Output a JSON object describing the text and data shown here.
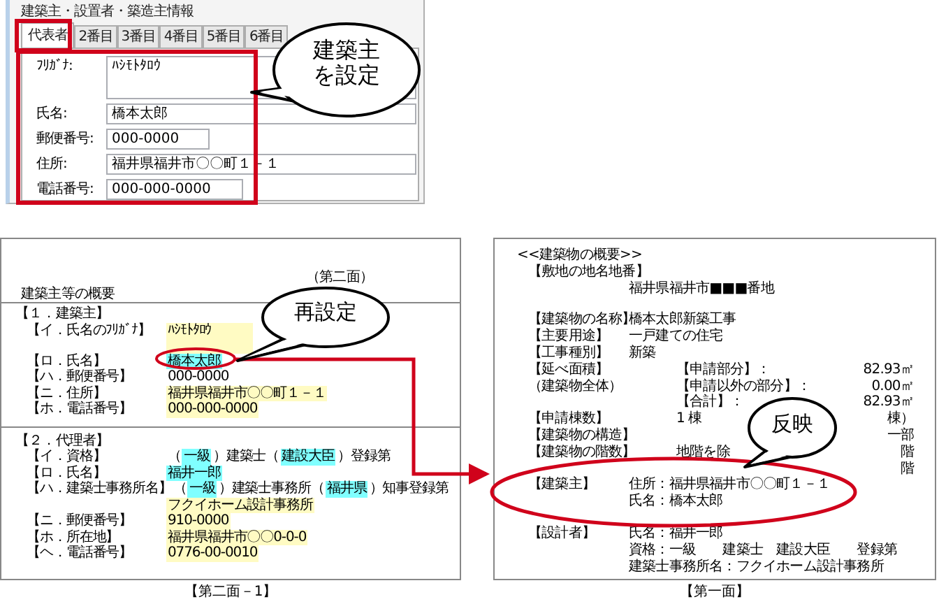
{
  "dialog": {
    "group_title": "建築主・設置者・築造主情報",
    "tabs": [
      {
        "label": "代表者",
        "selected": true
      },
      {
        "label": "2番目",
        "selected": false
      },
      {
        "label": "3番目",
        "selected": false
      },
      {
        "label": "4番目",
        "selected": false
      },
      {
        "label": "5番目",
        "selected": false
      },
      {
        "label": "6番目",
        "selected": false
      }
    ],
    "fields": [
      {
        "label": "ﾌﾘｶﾞﾅ:",
        "value": "ﾊｼﾓﾄﾀﾛｳ",
        "kind": "multiline"
      },
      {
        "label": "氏名:",
        "value": "橋本太郎",
        "kind": "wide"
      },
      {
        "label": "郵便番号:",
        "value": "000-0000",
        "kind": "short"
      },
      {
        "label": "住所:",
        "value": "福井県福井市〇〇町１－１",
        "kind": "wide"
      },
      {
        "label": "電話番号:",
        "value": "000-000-0000",
        "kind": "medium"
      }
    ],
    "callout": [
      "建築主",
      "を設定"
    ]
  },
  "form_page_2": {
    "page_label": "（第二面）",
    "title": "建築主等の概要",
    "sections": [
      {
        "heading": "【１．建築主】",
        "rows": [
          {
            "label": "【イ．氏名のﾌﾘｶﾞﾅ】",
            "cells": [
              {
                "text": "ﾊｼﾓﾄﾀﾛｳ",
                "kind": "tall"
              }
            ]
          },
          {
            "label": "【ロ．氏名】",
            "cells": [
              {
                "text": "橋本太郎",
                "kind": "select"
              }
            ]
          },
          {
            "label": "【ハ．郵便番号】",
            "cells": [
              {
                "text": "000-0000",
                "kind": "plain"
              }
            ]
          },
          {
            "label": "【ニ．住所】",
            "cells": [
              {
                "text": "福井県福井市〇〇町１－１",
                "kind": "text"
              }
            ]
          },
          {
            "label": "【ホ．電話番号】",
            "cells": [
              {
                "text": "000-000-0000",
                "kind": "text"
              }
            ]
          }
        ]
      },
      {
        "heading": "【２．代理者】",
        "rows": [
          {
            "label": "【イ．資格】",
            "cells": [
              {
                "text": "（",
                "kind": "plain"
              },
              {
                "text": "一級",
                "kind": "select"
              },
              {
                "text": "）建築士（",
                "kind": "plain"
              },
              {
                "text": "建設大臣",
                "kind": "select"
              },
              {
                "text": "）登録第",
                "kind": "plain"
              }
            ]
          },
          {
            "label": "【ロ．氏名】",
            "cells": [
              {
                "text": "福井一郎",
                "kind": "select"
              }
            ]
          },
          {
            "label": "【ハ．建築士事務所名】",
            "cells": [
              {
                "text": "（",
                "kind": "plain"
              },
              {
                "text": "一級",
                "kind": "select"
              },
              {
                "text": "）建築士事務所（",
                "kind": "plain"
              },
              {
                "text": "福井県",
                "kind": "select"
              },
              {
                "text": "）知事登録第",
                "kind": "plain"
              }
            ]
          },
          {
            "cells": [
              {
                "text": "フクイホーム設計事務所",
                "kind": "text"
              }
            ]
          },
          {
            "label": "【ニ．郵便番号】",
            "cells": [
              {
                "text": "910-0000",
                "kind": "text"
              }
            ]
          },
          {
            "label": "【ホ．所在地】",
            "cells": [
              {
                "text": "福井県福井市〇〇0-0-0",
                "kind": "text"
              }
            ]
          },
          {
            "label": "【ヘ．電話番号】",
            "cells": [
              {
                "text": "0776-00-0010",
                "kind": "text"
              }
            ]
          }
        ]
      }
    ],
    "callout": "再設定",
    "caption": "【第二面－1】"
  },
  "form_page_1": {
    "heading": "<<建築物の概要>>",
    "blocks": [
      {
        "rows": [
          {
            "cells": [
              "【敷地の地名地番】",
              "",
              "",
              ""
            ]
          },
          {
            "cells": [
              "",
              "福井県福井市■■■番地",
              "",
              ""
            ]
          }
        ]
      },
      {
        "rows": [
          {
            "cells": [
              "【建築物の名称】",
              "橋本太郎新築工事",
              "",
              ""
            ]
          },
          {
            "cells": [
              "【主要用途】",
              "一戸建ての住宅",
              "",
              ""
            ]
          },
          {
            "cells": [
              "【工事種別】",
              "新築",
              "",
              ""
            ]
          },
          {
            "cells": [
              "【延べ面積】",
              "",
              "【申請部分】：",
              "82.93㎡"
            ]
          },
          {
            "cells": [
              "（建築物全体）",
              "",
              "【申請以外の部分】：",
              "0.00㎡"
            ]
          },
          {
            "cells": [
              "",
              "",
              "【合計】：",
              "82.93㎡"
            ]
          },
          {
            "cells": [
              "【申請棟数】",
              "",
              "1 棟",
              "棟）"
            ]
          },
          {
            "cells": [
              "【建築物の構造】",
              "",
              "",
              "一部"
            ]
          },
          {
            "cells": [
              "【建築物の階数】",
              "",
              "地階を除",
              "階"
            ]
          },
          {
            "cells": [
              "",
              "",
              "",
              "階"
            ]
          },
          {
            "cells": [
              "【建築主】",
              "住所：福井県福井市〇〇町１－１",
              "",
              ""
            ]
          },
          {
            "cells": [
              "",
              "氏名：橋本太郎",
              "",
              ""
            ]
          }
        ]
      },
      {
        "rows": [
          {
            "cells": [
              "【設計者】",
              "氏名：福井一郎",
              "",
              ""
            ]
          },
          {
            "cells": [
              "",
              "資格：一級　　建築士　建設大臣　　登録第",
              "",
              ""
            ]
          },
          {
            "cells": [
              "",
              "建築士事務所名：フクイホーム設計事務所",
              "",
              ""
            ]
          }
        ]
      }
    ],
    "callout": "反映",
    "caption": "【第一面】"
  }
}
